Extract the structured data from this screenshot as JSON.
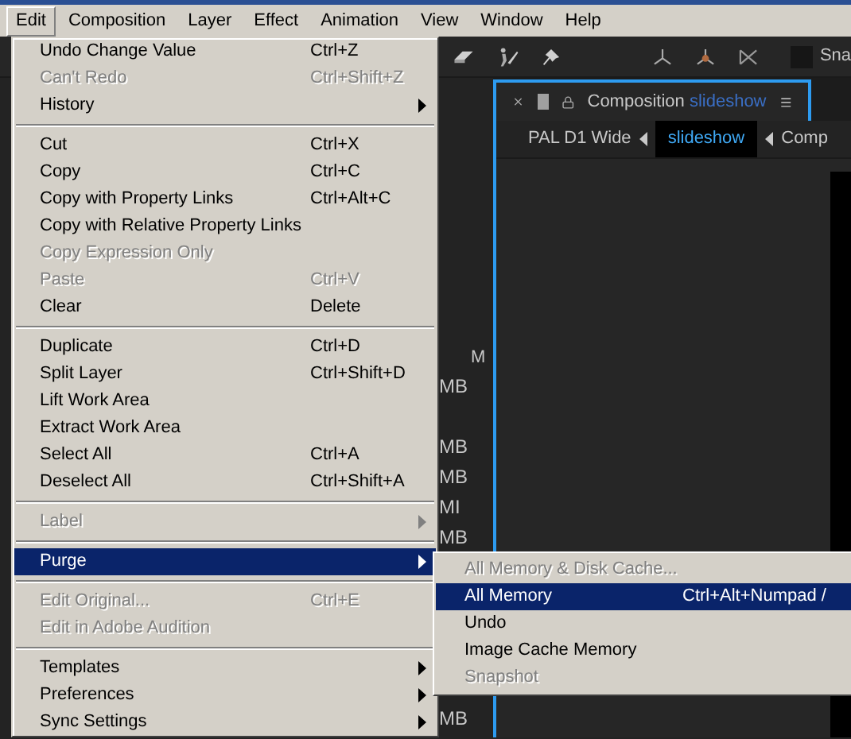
{
  "menubar": [
    {
      "label": "Edit",
      "selected": true
    },
    {
      "label": "Composition",
      "selected": false
    },
    {
      "label": "Layer",
      "selected": false
    },
    {
      "label": "Effect",
      "selected": false
    },
    {
      "label": "Animation",
      "selected": false
    },
    {
      "label": "View",
      "selected": false
    },
    {
      "label": "Window",
      "selected": false
    },
    {
      "label": "Help",
      "selected": false
    }
  ],
  "toolbar": {
    "snap_label": "Sna",
    "snap_checked": false
  },
  "side_column": {
    "header": "M",
    "cells": [
      "MB",
      "MB",
      "MB",
      "MI",
      "MB",
      "MB"
    ]
  },
  "composition_panel": {
    "tab_title": "Composition",
    "tab_name": "slideshow",
    "breadcrumbs": [
      {
        "label": "PAL D1 Wide",
        "selected": false
      },
      {
        "label": "slideshow",
        "selected": true
      },
      {
        "label": "Comp",
        "selected": false
      }
    ]
  },
  "edit_menu": {
    "items": [
      {
        "kind": "item",
        "label": "Undo Change Value",
        "shortcut": "Ctrl+Z",
        "disabled": false,
        "submenu": false,
        "selected": false
      },
      {
        "kind": "item",
        "label": "Can't Redo",
        "shortcut": "Ctrl+Shift+Z",
        "disabled": true,
        "submenu": false,
        "selected": false
      },
      {
        "kind": "item",
        "label": "History",
        "disabled": false,
        "submenu": true,
        "selected": false
      },
      {
        "kind": "separator"
      },
      {
        "kind": "item",
        "label": "Cut",
        "shortcut": "Ctrl+X",
        "disabled": false,
        "submenu": false,
        "selected": false
      },
      {
        "kind": "item",
        "label": "Copy",
        "shortcut": "Ctrl+C",
        "disabled": false,
        "submenu": false,
        "selected": false
      },
      {
        "kind": "item",
        "label": "Copy with Property Links",
        "shortcut": "Ctrl+Alt+C",
        "disabled": false,
        "submenu": false,
        "selected": false
      },
      {
        "kind": "item",
        "label": "Copy with Relative Property Links",
        "disabled": false,
        "submenu": false,
        "selected": false
      },
      {
        "kind": "item",
        "label": "Copy Expression Only",
        "disabled": true,
        "submenu": false,
        "selected": false
      },
      {
        "kind": "item",
        "label": "Paste",
        "shortcut": "Ctrl+V",
        "disabled": true,
        "submenu": false,
        "selected": false
      },
      {
        "kind": "item",
        "label": "Clear",
        "shortcut": "Delete",
        "disabled": false,
        "submenu": false,
        "selected": false
      },
      {
        "kind": "separator"
      },
      {
        "kind": "item",
        "label": "Duplicate",
        "shortcut": "Ctrl+D",
        "disabled": false,
        "submenu": false,
        "selected": false
      },
      {
        "kind": "item",
        "label": "Split Layer",
        "shortcut": "Ctrl+Shift+D",
        "disabled": false,
        "submenu": false,
        "selected": false
      },
      {
        "kind": "item",
        "label": "Lift Work Area",
        "disabled": false,
        "submenu": false,
        "selected": false
      },
      {
        "kind": "item",
        "label": "Extract Work Area",
        "disabled": false,
        "submenu": false,
        "selected": false
      },
      {
        "kind": "item",
        "label": "Select All",
        "shortcut": "Ctrl+A",
        "disabled": false,
        "submenu": false,
        "selected": false
      },
      {
        "kind": "item",
        "label": "Deselect All",
        "shortcut": "Ctrl+Shift+A",
        "disabled": false,
        "submenu": false,
        "selected": false
      },
      {
        "kind": "separator"
      },
      {
        "kind": "item",
        "label": "Label",
        "disabled": true,
        "submenu": true,
        "selected": false
      },
      {
        "kind": "separator"
      },
      {
        "kind": "item",
        "label": "Purge",
        "disabled": false,
        "submenu": true,
        "selected": true
      },
      {
        "kind": "separator"
      },
      {
        "kind": "item",
        "label": "Edit Original...",
        "shortcut": "Ctrl+E",
        "disabled": true,
        "submenu": false,
        "selected": false
      },
      {
        "kind": "item",
        "label": "Edit in Adobe Audition",
        "disabled": true,
        "submenu": false,
        "selected": false
      },
      {
        "kind": "separator"
      },
      {
        "kind": "item",
        "label": "Templates",
        "disabled": false,
        "submenu": true,
        "selected": false
      },
      {
        "kind": "item",
        "label": "Preferences",
        "disabled": false,
        "submenu": true,
        "selected": false
      },
      {
        "kind": "item",
        "label": "Sync Settings",
        "disabled": false,
        "submenu": true,
        "selected": false
      }
    ]
  },
  "purge_submenu": {
    "items": [
      {
        "label": "All Memory & Disk Cache...",
        "disabled": true,
        "selected": false
      },
      {
        "label": "All Memory",
        "shortcut": "Ctrl+Alt+Numpad /",
        "disabled": false,
        "selected": true
      },
      {
        "label": "Undo",
        "disabled": false,
        "selected": false
      },
      {
        "label": "Image Cache Memory",
        "disabled": false,
        "selected": false
      },
      {
        "label": "Snapshot",
        "disabled": true,
        "selected": false
      }
    ]
  }
}
